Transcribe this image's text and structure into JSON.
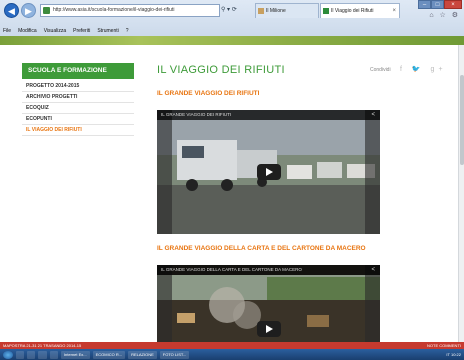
{
  "browser": {
    "url": "http://www.asia.it/scuola-formazione/il-viaggio-dei-rifiuti",
    "address_tools": "⚲ ▾ ⟳",
    "tabs": [
      {
        "label": "Il Milione"
      },
      {
        "label": "Il Viaggio dei Rifiuti"
      }
    ],
    "menu": [
      "File",
      "Modifica",
      "Visualizza",
      "Preferiti",
      "Strumenti",
      "?"
    ]
  },
  "sidebar": {
    "title": "SCUOLA E FORMAZIONE",
    "items": [
      {
        "label": "PROGETTO 2014-2015",
        "active": false
      },
      {
        "label": "ARCHIVIO PROGETTI",
        "active": false
      },
      {
        "label": "ECOQUIZ",
        "active": false
      },
      {
        "label": "ECOPUNTI",
        "active": false
      },
      {
        "label": "IL VIAGGIO DEI RIFIUTI",
        "active": true
      }
    ]
  },
  "main": {
    "title": "IL VIAGGIO DEI RIFIUTI",
    "share_label": "Condividi",
    "share_icons": "f  🐦  g+",
    "sections": [
      {
        "heading": "IL GRANDE VIAGGIO DEI RIFIUTI",
        "video_title": "IL GRANDE VIAGGIO DEI RIFIUTI"
      },
      {
        "heading": "IL GRANDE VIAGGIO DELLA CARTA E DEL CARTONE DA MACERO",
        "video_title": "IL GRANDE VIAGGIO DELLA CARTA E DEL CARTONE DA MACERO"
      }
    ]
  },
  "statusbar": {
    "left": "MAPOSTRA 21-31 21    TRASANDO 2014-15",
    "right": "NOTE   COMMENTI"
  },
  "taskbar": {
    "tasks": [
      "",
      "",
      "",
      "",
      "Internet Ex...",
      "ECOMICO R...",
      "RELAZIONE",
      "FOTO LIST..."
    ],
    "tray": "IT  10:22"
  },
  "colors": {
    "accent_green": "#3e9b39",
    "accent_orange": "#e87511"
  }
}
